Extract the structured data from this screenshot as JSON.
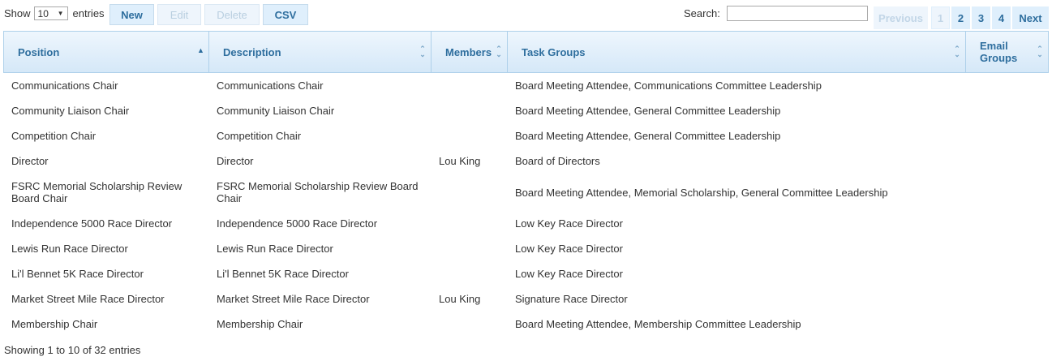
{
  "length": {
    "prefix": "Show",
    "value": "10",
    "suffix": "entries"
  },
  "buttons": {
    "new": "New",
    "edit": "Edit",
    "delete": "Delete",
    "csv": "CSV"
  },
  "search": {
    "label": "Search:",
    "value": ""
  },
  "pagination": {
    "previous": "Previous",
    "pages": [
      "1",
      "2",
      "3",
      "4"
    ],
    "current": "1",
    "next": "Next"
  },
  "columns": [
    "Position",
    "Description",
    "Members",
    "Task Groups",
    "Email Groups"
  ],
  "rows": [
    [
      "Communications Chair",
      "Communications Chair",
      "",
      "Board Meeting Attendee, Communications Committee Leadership",
      ""
    ],
    [
      "Community Liaison Chair",
      "Community Liaison Chair",
      "",
      "Board Meeting Attendee, General Committee Leadership",
      ""
    ],
    [
      "Competition Chair",
      "Competition Chair",
      "",
      "Board Meeting Attendee, General Committee Leadership",
      ""
    ],
    [
      "Director",
      "Director",
      "Lou King",
      "Board of Directors",
      ""
    ],
    [
      "FSRC Memorial Scholarship Review Board Chair",
      "FSRC Memorial Scholarship Review Board Chair",
      "",
      "Board Meeting Attendee, Memorial Scholarship, General Committee Leadership",
      ""
    ],
    [
      "Independence 5000 Race Director",
      "Independence 5000 Race Director",
      "",
      "Low Key Race Director",
      ""
    ],
    [
      "Lewis Run Race Director",
      "Lewis Run Race Director",
      "",
      "Low Key Race Director",
      ""
    ],
    [
      "Li'l Bennet 5K Race Director",
      "Li'l Bennet 5K Race Director",
      "",
      "Low Key Race Director",
      ""
    ],
    [
      "Market Street Mile Race Director",
      "Market Street Mile Race Director",
      "Lou King",
      "Signature Race Director",
      ""
    ],
    [
      "Membership Chair",
      "Membership Chair",
      "",
      "Board Meeting Attendee, Membership Committee Leadership",
      ""
    ]
  ],
  "info": "Showing 1 to 10 of 32 entries"
}
